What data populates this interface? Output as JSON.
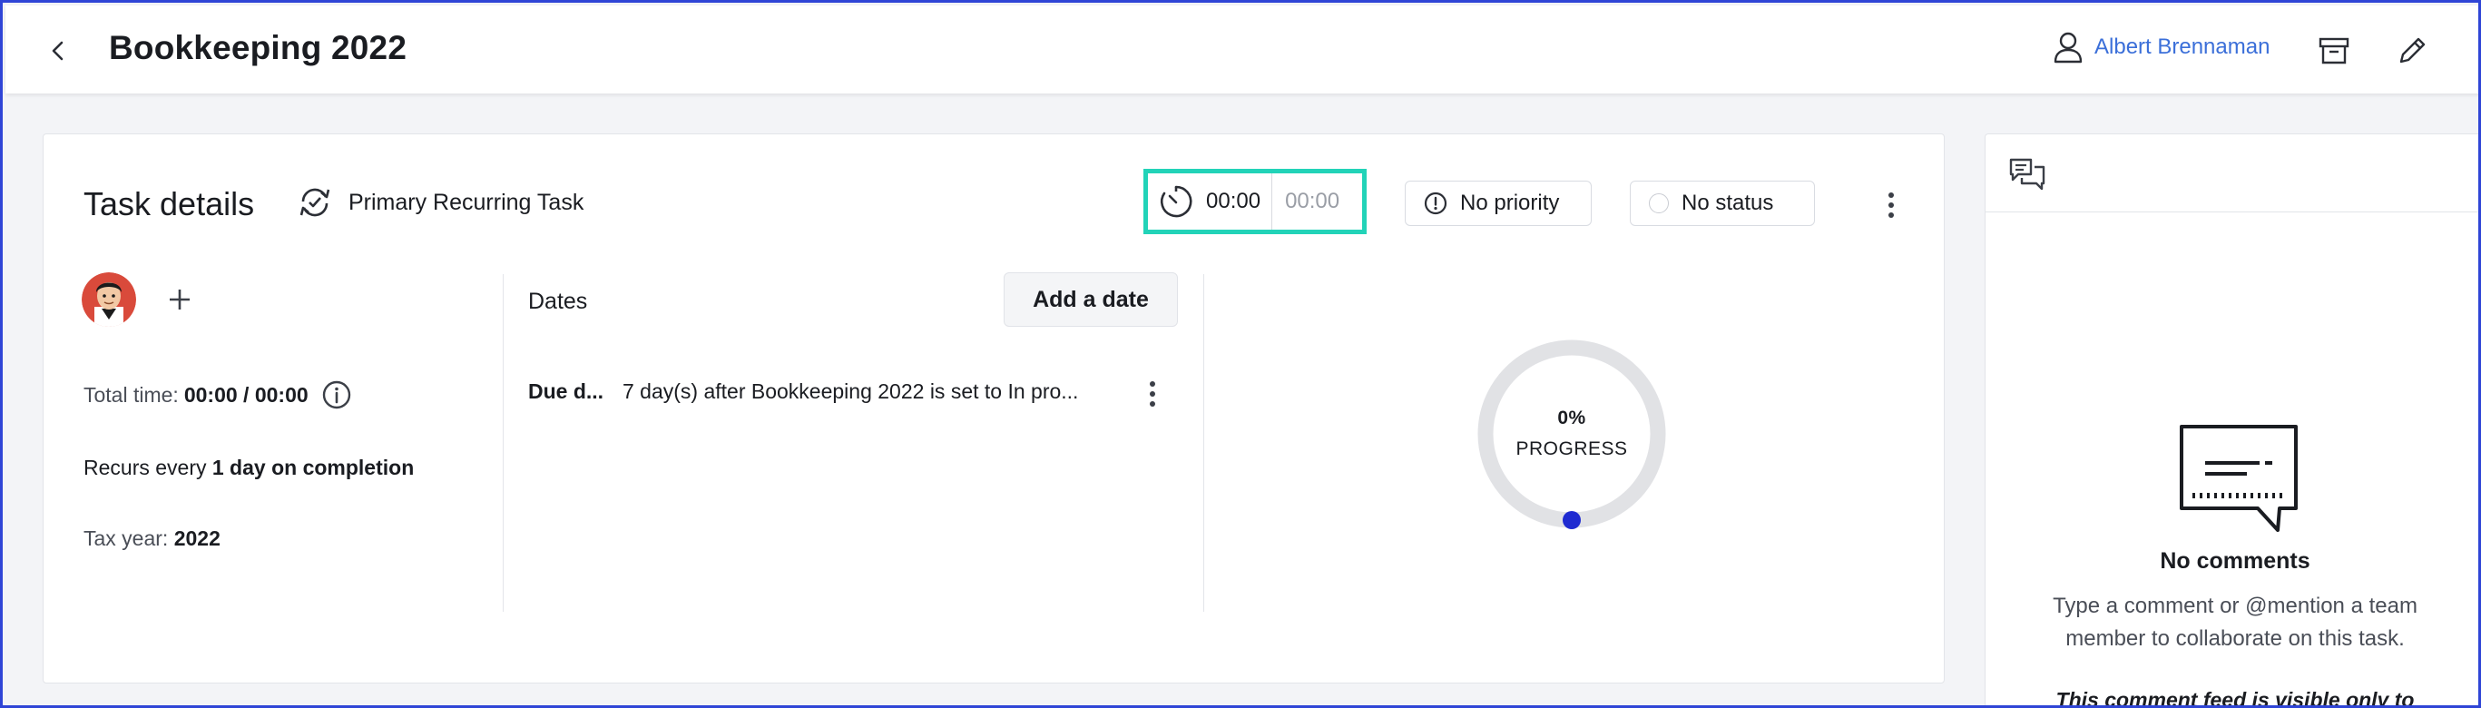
{
  "header": {
    "title": "Bookkeeping 2022",
    "user_name": "Albert Brennaman"
  },
  "task": {
    "section_title": "Task details",
    "recurring_label": "Primary Recurring Task",
    "timer": {
      "elapsed": "00:00",
      "estimate": "00:00",
      "accent_color": "#22d3b8"
    },
    "priority_label": "No priority",
    "status_label": "No status",
    "total_time_label": "Total time:",
    "total_time_value": "00:00 / 00:00",
    "recurs_prefix": "Recurs every",
    "recurs_value": "1 day on completion",
    "tax_year_label": "Tax year:",
    "tax_year_value": "2022",
    "dates_label": "Dates",
    "add_date_label": "Add a date",
    "due": {
      "key": "Due d...",
      "value": "7 day(s) after Bookkeeping 2022 is set to In pro..."
    },
    "progress": {
      "percent_text": "0%",
      "label": "PROGRESS",
      "value": 0,
      "indicator_color": "#1f2bd1"
    }
  },
  "comments": {
    "empty_title": "No comments",
    "hint": "Type a comment or @mention a team member to collaborate on this task.",
    "visibility_note": "This comment feed is visible only to"
  },
  "colors": {
    "link": "#3b6fd9",
    "frame": "#2f45d6"
  }
}
